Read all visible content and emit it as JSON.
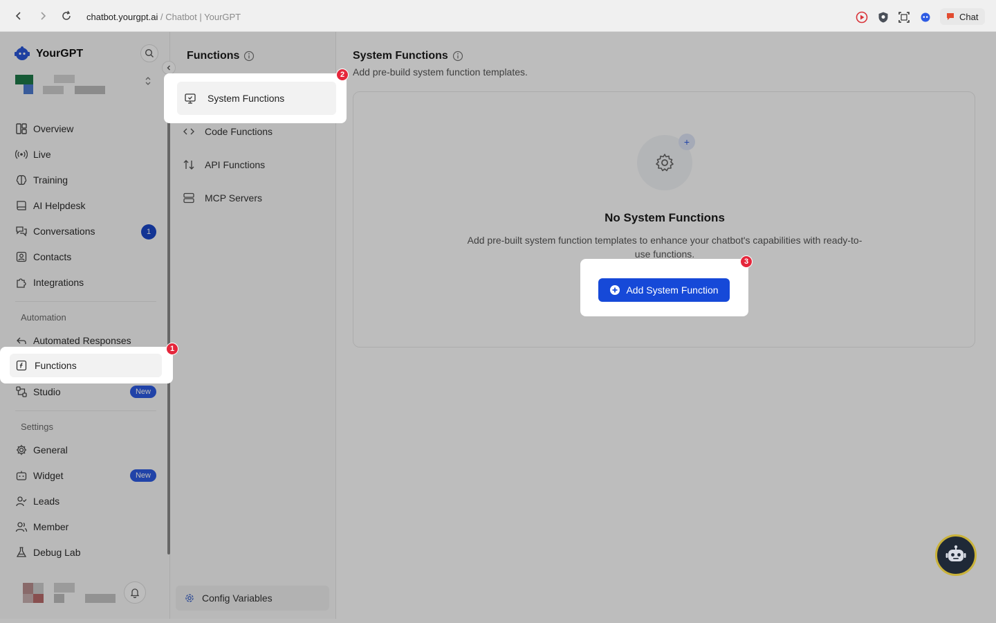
{
  "browser": {
    "domain": "chatbot.yourgpt.ai",
    "separator": "/",
    "page_title": "Chatbot | YourGPT",
    "chat_label": "Chat"
  },
  "brand": {
    "name": "YourGPT"
  },
  "sidebar": {
    "items": [
      {
        "label": "Overview",
        "icon": "layout-icon"
      },
      {
        "label": "Live",
        "icon": "broadcast-icon"
      },
      {
        "label": "Training",
        "icon": "brain-icon"
      },
      {
        "label": "AI Helpdesk",
        "icon": "book-icon"
      },
      {
        "label": "Conversations",
        "icon": "chat-icon",
        "badge": "1"
      },
      {
        "label": "Contacts",
        "icon": "contacts-icon"
      },
      {
        "label": "Integrations",
        "icon": "puzzle-icon"
      }
    ],
    "automation_label": "Automation",
    "automation_items": [
      {
        "label": "Automated Responses",
        "icon": "reply-icon"
      },
      {
        "label": "Functions",
        "icon": "function-icon"
      },
      {
        "label": "Studio",
        "icon": "flow-icon",
        "badge": "New"
      }
    ],
    "settings_label": "Settings",
    "settings_items": [
      {
        "label": "General",
        "icon": "gear-icon"
      },
      {
        "label": "Widget",
        "icon": "widget-icon",
        "badge": "New"
      },
      {
        "label": "Leads",
        "icon": "user-check-icon"
      },
      {
        "label": "Member",
        "icon": "users-icon"
      },
      {
        "label": "Debug Lab",
        "icon": "flask-icon"
      }
    ]
  },
  "submenu": {
    "title": "Functions",
    "items": [
      {
        "label": "System Functions",
        "icon": "monitor-icon"
      },
      {
        "label": "Code Functions",
        "icon": "code-icon"
      },
      {
        "label": "API Functions",
        "icon": "arrows-icon"
      },
      {
        "label": "MCP Servers",
        "icon": "server-icon"
      }
    ],
    "config_label": "Config Variables"
  },
  "main": {
    "title": "System Functions",
    "subtitle": "Add pre-build system function templates.",
    "empty_title": "No System Functions",
    "empty_desc": "Add pre-built system function templates to enhance your chatbot's capabilities with ready-to-use functions.",
    "add_button": "Add System Function"
  },
  "steps": [
    "1",
    "2",
    "3"
  ],
  "colors": {
    "primary": "#1649d8",
    "step": "#e5263b",
    "badge": "#1a47c8"
  }
}
